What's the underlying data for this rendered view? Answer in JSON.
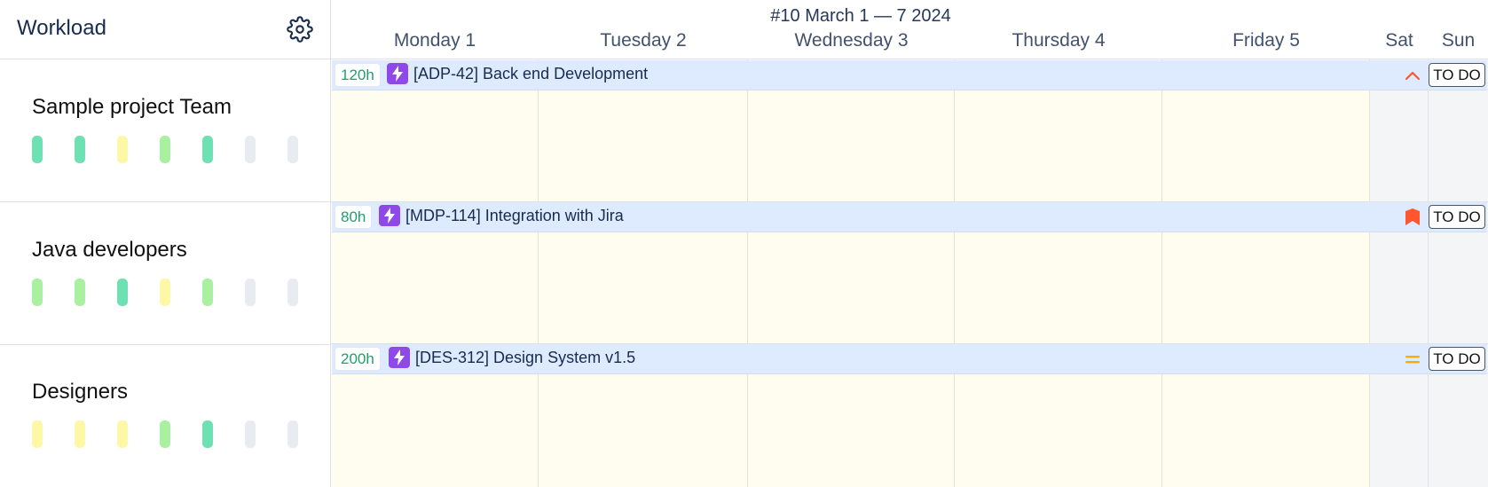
{
  "header": {
    "title": "Workload",
    "settings_icon": "gear-icon",
    "week_label": "#10 March 1 — 7 2024"
  },
  "days": [
    {
      "label": "Monday 1",
      "type": "workday"
    },
    {
      "label": "Tuesday 2",
      "type": "workday"
    },
    {
      "label": "Wednesday 3",
      "type": "workday"
    },
    {
      "label": "Thursday 4",
      "type": "workday"
    },
    {
      "label": "Friday 5",
      "type": "workday"
    },
    {
      "label": "Sat",
      "type": "weekend"
    },
    {
      "label": "Sun",
      "type": "weekend"
    }
  ],
  "teams": [
    {
      "name": "Sample project Team",
      "load_indicators": [
        "green",
        "green",
        "yellow",
        "light-green",
        "green",
        "empty",
        "empty"
      ],
      "task": {
        "hours": "120h",
        "icon": "epic-lightning-icon",
        "title": "[ADP-42] Back end Development",
        "priority": "high-chevron-icon",
        "status": "TO DO"
      }
    },
    {
      "name": "Java developers",
      "load_indicators": [
        "light-green",
        "light-green",
        "green",
        "yellow",
        "light-green",
        "empty",
        "empty"
      ],
      "task": {
        "hours": "80h",
        "icon": "epic-lightning-icon",
        "title": "[MDP-114] Integration with Jira",
        "priority": "highest-flag-icon",
        "status": "TO DO"
      }
    },
    {
      "name": "Designers",
      "load_indicators": [
        "yellow",
        "yellow",
        "yellow",
        "light-green",
        "green",
        "empty",
        "empty"
      ],
      "task": {
        "hours": "200h",
        "icon": "epic-lightning-icon",
        "title": "[DES-312] Design System v1.5",
        "priority": "medium-equals-icon",
        "status": "TO DO"
      }
    }
  ],
  "colors": {
    "green": "#6ee0b3",
    "light-green": "#a9f0a1",
    "yellow": "#fdf7a8",
    "empty": "#e8ebef",
    "workday_bg": "#fefdf0",
    "weekend_bg": "#f4f5f7",
    "task_bar": "#deebff",
    "epic": "#8f49e6",
    "priority_high": "#ff5630",
    "priority_medium": "#ffab00"
  }
}
